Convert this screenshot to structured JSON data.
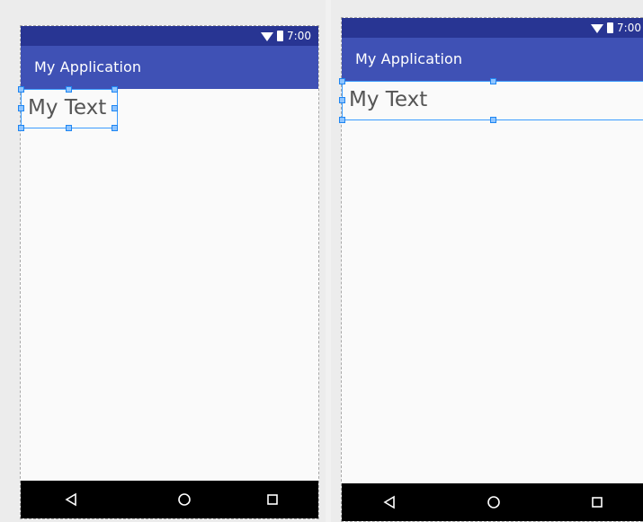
{
  "screens": [
    {
      "status_time": "7:00",
      "app_title": "My Application",
      "text_label": "My Text",
      "nav": {
        "back": "back-triangle",
        "home": "home-circle",
        "recent": "recent-square"
      }
    },
    {
      "status_time": "7:00",
      "app_title": "My Application",
      "text_label": "My Text",
      "nav": {
        "back": "back-triangle",
        "home": "home-circle",
        "recent": "recent-square"
      }
    }
  ],
  "colors": {
    "status_bar": "#283593",
    "app_bar": "#3f51b5",
    "selection": "#3b9cff"
  }
}
